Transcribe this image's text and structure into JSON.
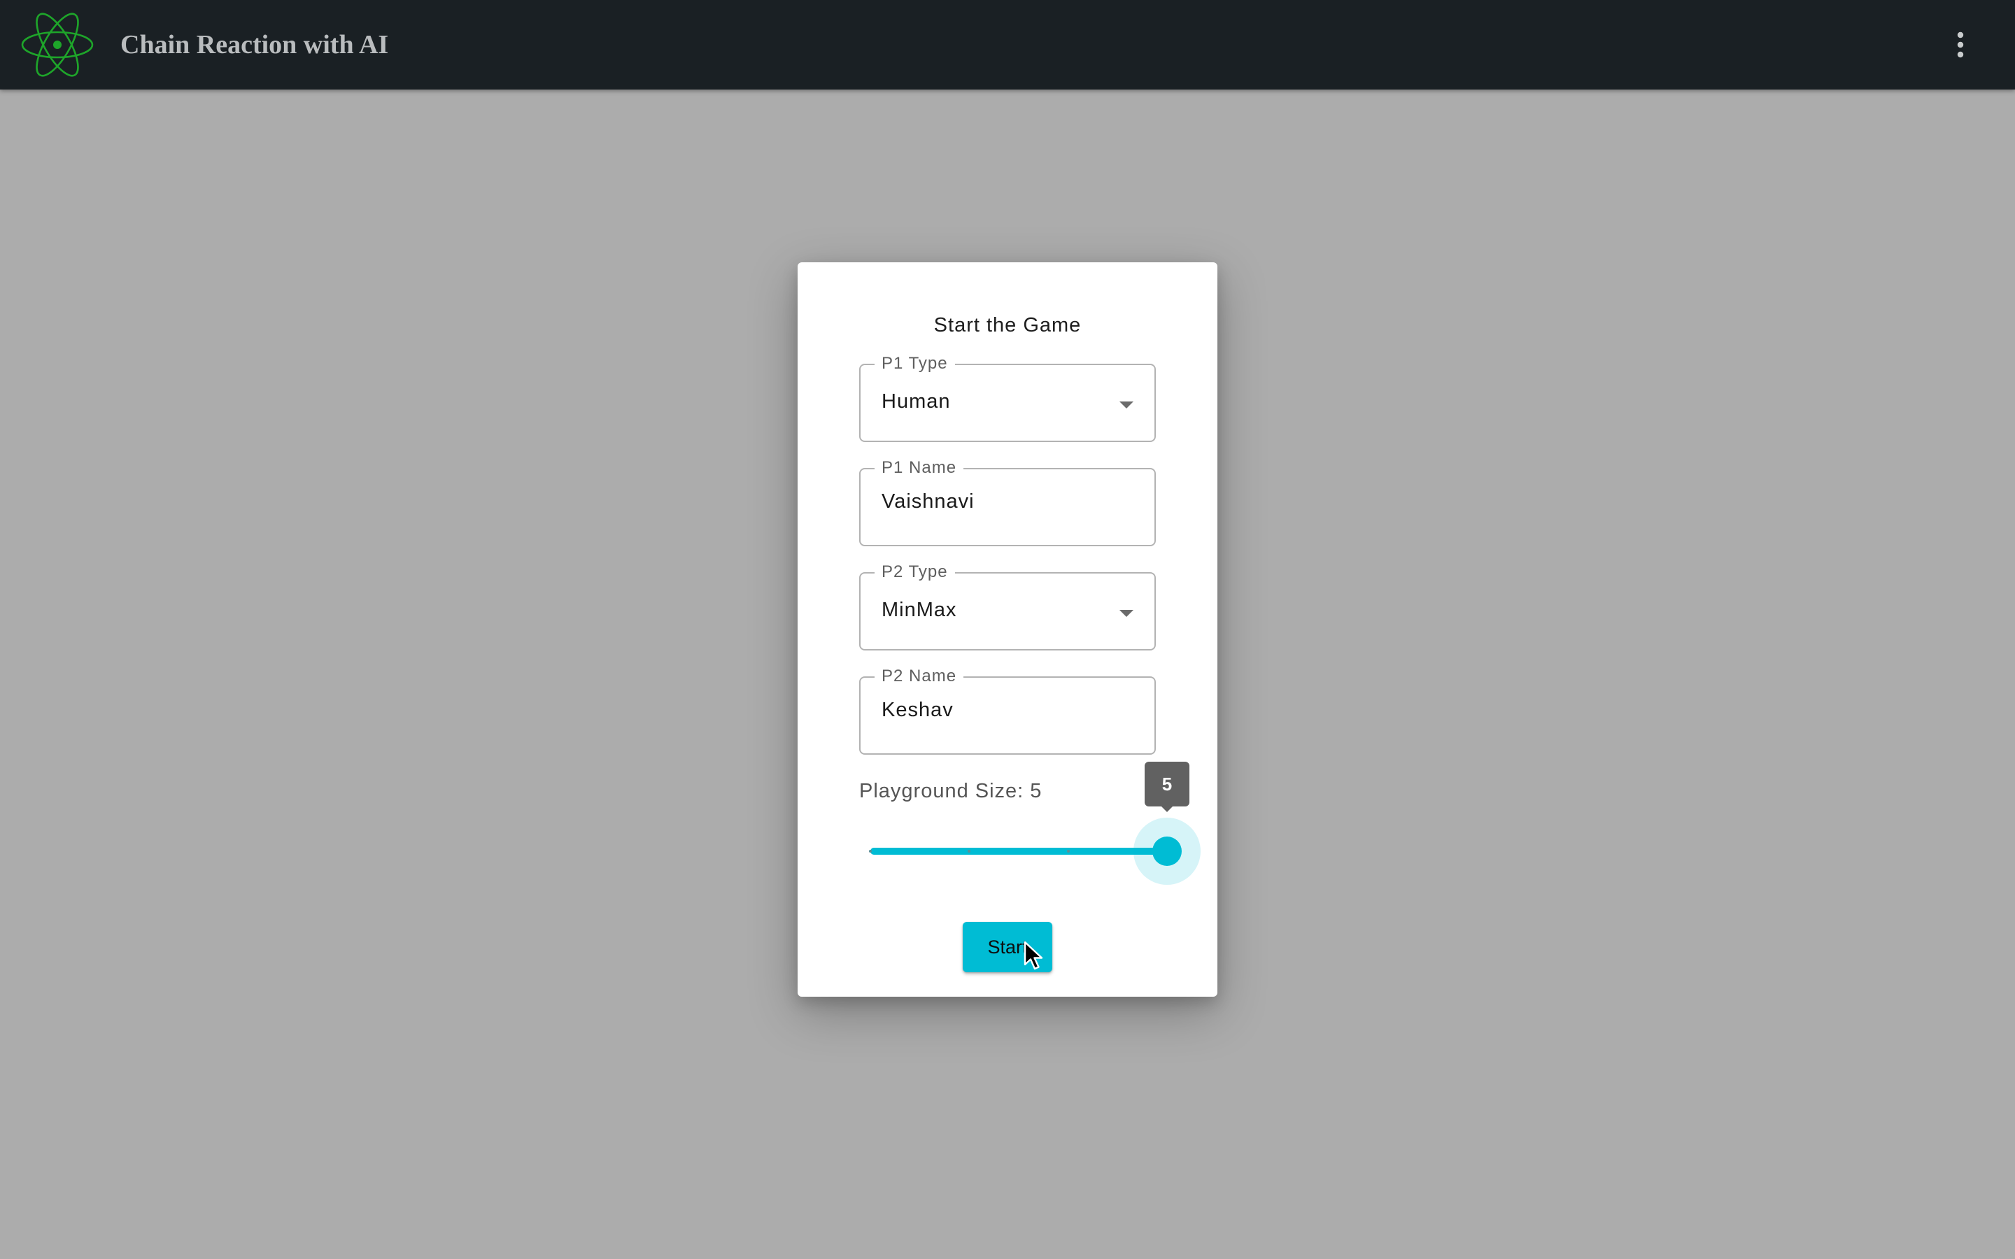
{
  "appbar": {
    "title": "Chain Reaction with AI",
    "logo_icon": "atom-icon",
    "logo_color": "#1ea52a",
    "menu_icon": "more-vertical-icon"
  },
  "dialog": {
    "title": "Start the Game",
    "p1_type": {
      "label": "P1 Type",
      "value": "Human"
    },
    "p1_name": {
      "label": "P1 Name",
      "value": "Vaishnavi"
    },
    "p2_type": {
      "label": "P2 Type",
      "value": "MinMax"
    },
    "p2_name": {
      "label": "P2 Name",
      "value": "Keshav"
    },
    "playground": {
      "label": "Playground Size: 5",
      "value": 5,
      "min": 2,
      "max": 5,
      "tooltip": "5"
    },
    "start_label": "Start"
  },
  "colors": {
    "accent": "#00bcd4",
    "appbar_bg": "#1a2024",
    "backdrop": "#acacac"
  }
}
